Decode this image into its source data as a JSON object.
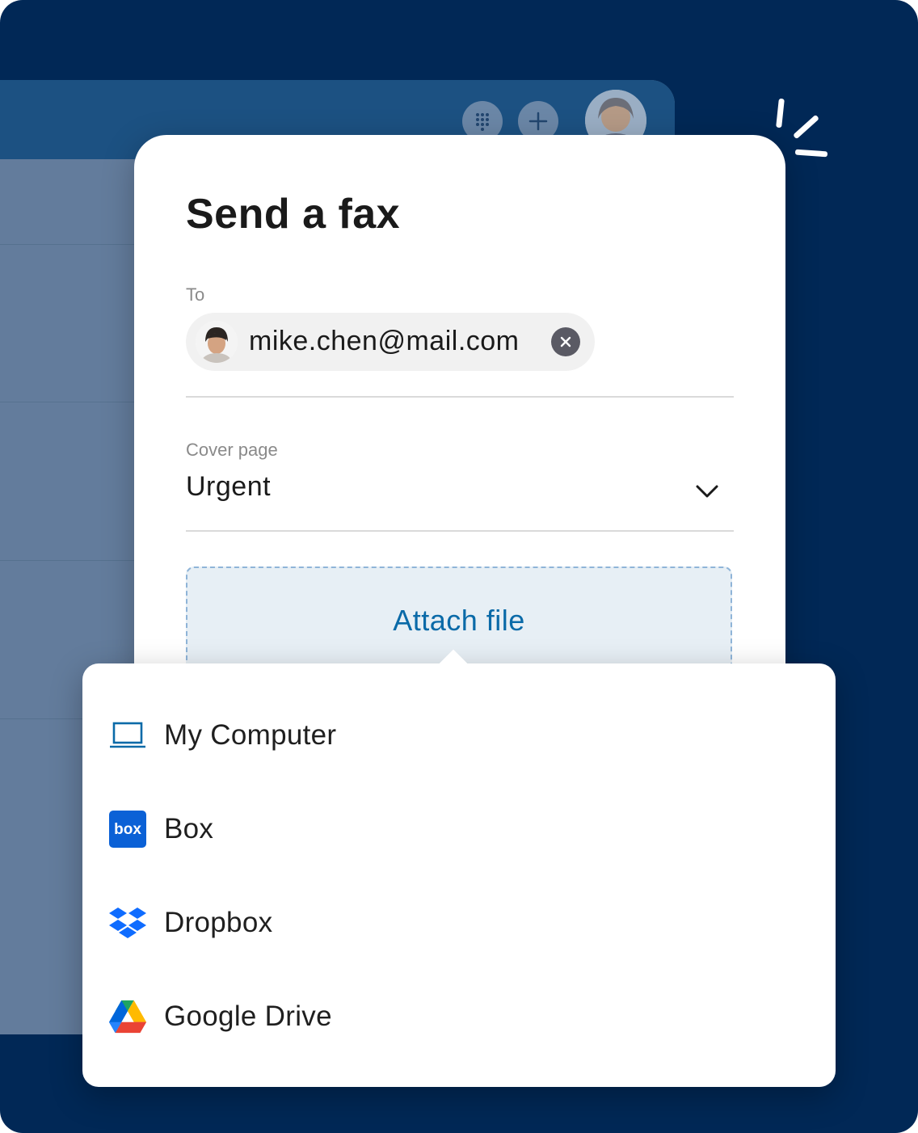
{
  "dialog": {
    "title": "Send a fax",
    "to_label": "To",
    "recipient_email": "mike.chen@mail.com",
    "cover_label": "Cover page",
    "cover_value": "Urgent",
    "attach_label": "Attach file"
  },
  "menu": {
    "items": [
      {
        "label": "My Computer",
        "icon": "laptop-icon"
      },
      {
        "label": "Box",
        "icon": "box-logo-icon",
        "icon_text": "box"
      },
      {
        "label": "Dropbox",
        "icon": "dropbox-logo-icon"
      },
      {
        "label": "Google Drive",
        "icon": "google-drive-logo-icon"
      }
    ]
  },
  "colors": {
    "background": "#012856",
    "app_topbar": "#1c5182",
    "app_body": "#637c9c",
    "accent_blue": "#0a6aa8",
    "box_blue": "#0b61d6",
    "dropbox_blue": "#0f6cff"
  }
}
